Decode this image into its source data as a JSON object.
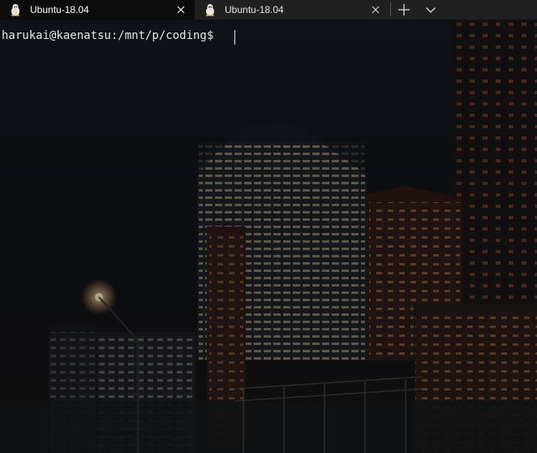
{
  "tabs": [
    {
      "title": "Ubuntu-18.04",
      "icon": "linux-tux-icon",
      "active": true
    },
    {
      "title": "Ubuntu-18.04",
      "icon": "linux-tux-icon",
      "active": false
    }
  ],
  "toolbar": {
    "new_tab_icon": "plus-icon",
    "dropdown_icon": "chevron-down-icon"
  },
  "terminal": {
    "prompt": "harukai@kaenatsu:/mnt/p/coding$ ",
    "background": "night city skyline"
  },
  "colors": {
    "tabbar": "#202020",
    "active_tab": "#0c0c0c",
    "text": "#ffffff"
  }
}
